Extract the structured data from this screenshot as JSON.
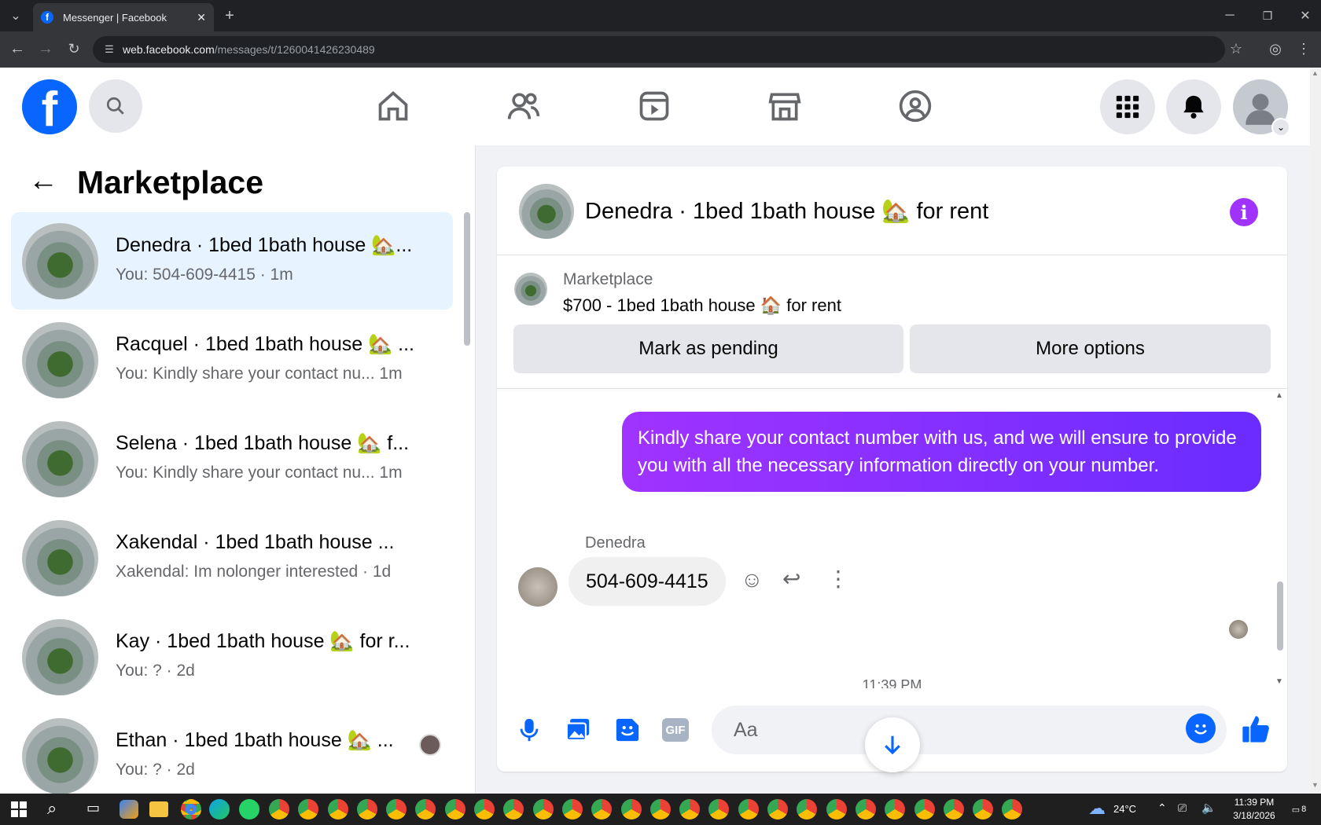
{
  "browser": {
    "tab_title": "Messenger | Facebook",
    "url_host": "web.facebook.com",
    "url_path": "/messages/t/1260041426230489"
  },
  "sidebar": {
    "title": "Marketplace",
    "conversations": [
      {
        "name": "Denedra · 1bed 1bath house 🏡...",
        "snippet": "You: 504-609-4415 · 1m",
        "active": true
      },
      {
        "name": "Racquel · 1bed 1bath house 🏡 ...",
        "snippet": "You: Kindly share your contact nu...  1m"
      },
      {
        "name": "Selena · 1bed 1bath house 🏡 f...",
        "snippet": "You: Kindly share your contact nu...  1m"
      },
      {
        "name": "Xakendal · 1bed 1bath house ...",
        "snippet": "Xakendal: Im nolonger interested · 1d"
      },
      {
        "name": "Kay · 1bed 1bath house 🏡 for r...",
        "snippet": "You: ? · 2d"
      },
      {
        "name": "Ethan · 1bed 1bath house 🏡 ...",
        "snippet": "You: ? · 2d"
      }
    ]
  },
  "chat": {
    "header_title": "Denedra · 1bed 1bath house 🏡 for rent",
    "listing_source": "Marketplace",
    "listing_title": "$700 - 1bed 1bath house 🏠 for rent",
    "mark_pending_label": "Mark as pending",
    "more_options_label": "More options",
    "outgoing_message": "Kindly share your contact number with us, and we will ensure to provide you with all the necessary information directly on your number.",
    "incoming_sender": "Denedra",
    "incoming_message": "504-609-4415",
    "timestamp": "11:39 PM",
    "composer_placeholder": "Aa",
    "gif_label": "GIF"
  },
  "taskbar": {
    "weather": "24°C",
    "time": "11:39 PM",
    "date": "3/18/2026",
    "notif_count": "8"
  },
  "colors": {
    "fb_blue": "#0866ff",
    "messenger_purple": "#a033ff",
    "bubble_gradient_end": "#6a2cff"
  }
}
